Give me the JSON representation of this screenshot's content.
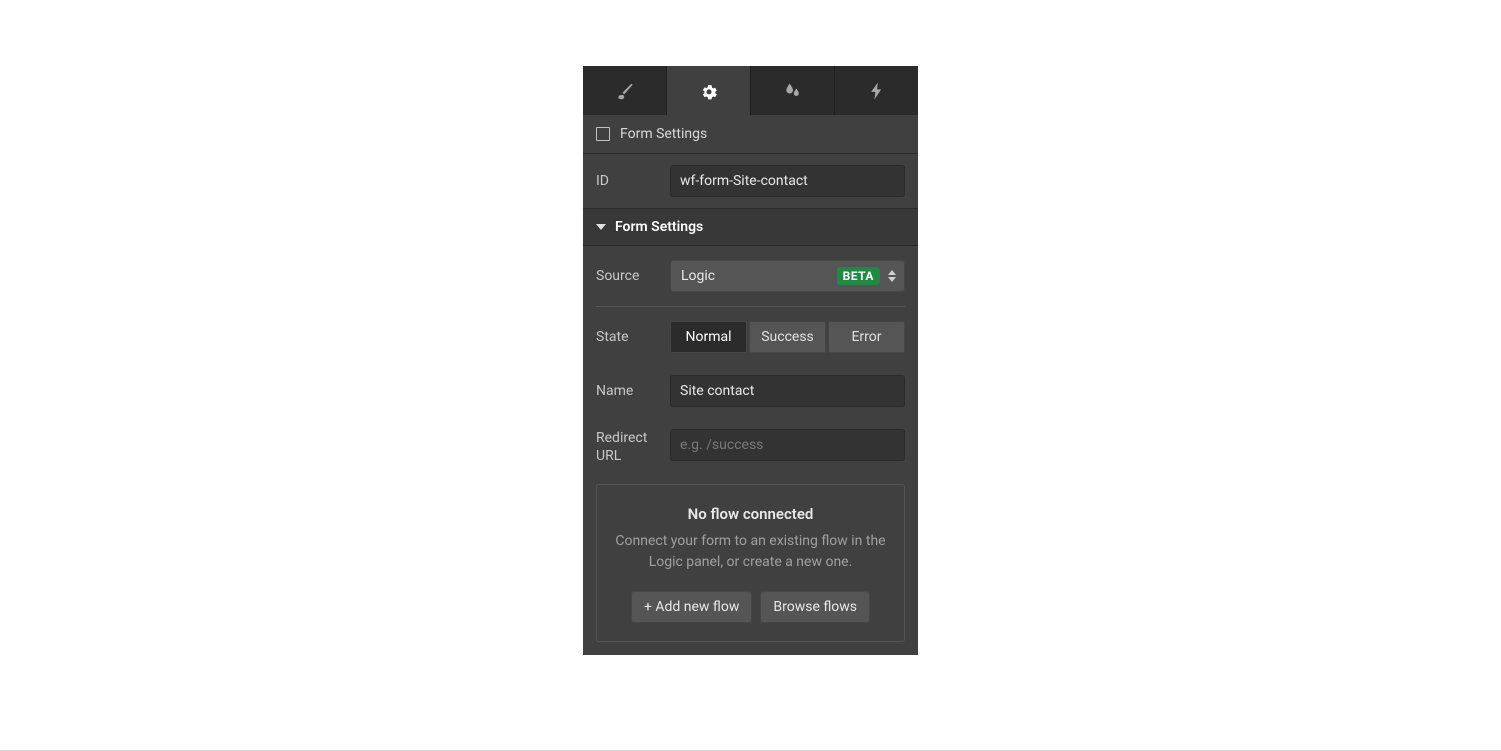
{
  "header": {
    "title": "Form Settings"
  },
  "id_row": {
    "label": "ID",
    "value": "wf-form-Site-contact"
  },
  "section": {
    "title": "Form Settings"
  },
  "source": {
    "label": "Source",
    "value": "Logic",
    "badge": "BETA"
  },
  "state": {
    "label": "State",
    "options": [
      "Normal",
      "Success",
      "Error"
    ],
    "selected": "Normal"
  },
  "name": {
    "label": "Name",
    "value": "Site contact"
  },
  "redirect": {
    "label": "Redirect URL",
    "placeholder": "e.g. /success",
    "value": ""
  },
  "flow": {
    "title": "No flow connected",
    "description": "Connect your form to an existing flow in the Logic panel, or create a new one.",
    "add_label": "+ Add new flow",
    "browse_label": "Browse flows"
  }
}
